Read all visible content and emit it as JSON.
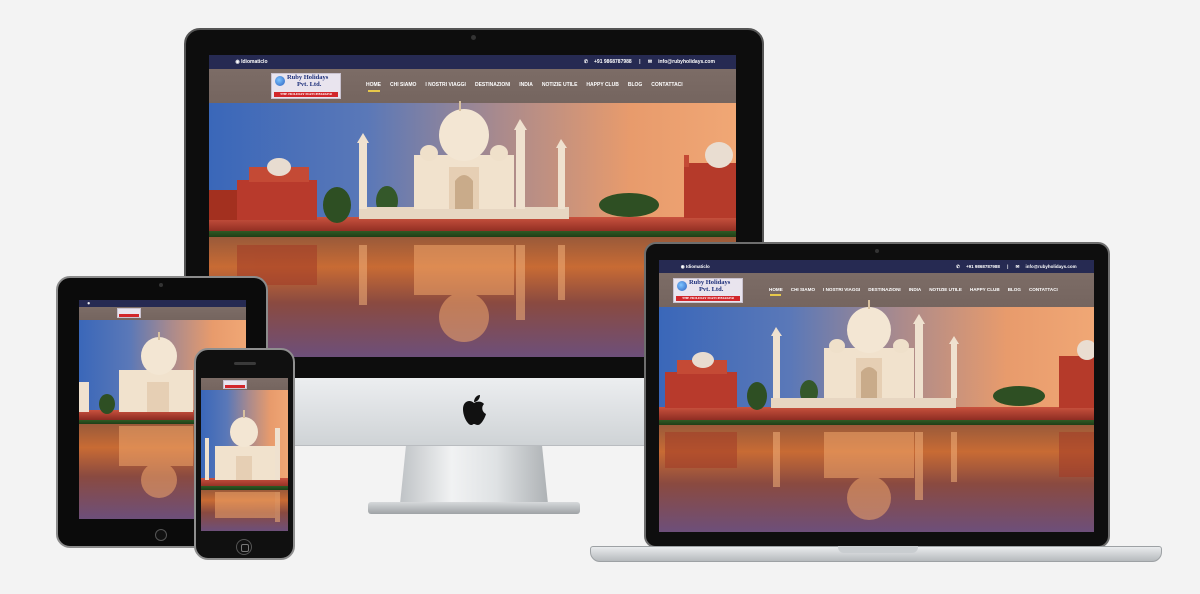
{
  "site": {
    "topbar": {
      "language": "Idiomaticlo",
      "phone": "+91 9868787988",
      "email": "info@rubyholidays.com",
      "separator": "|"
    },
    "logo": {
      "name_line1": "Ruby Holidays",
      "name_line2": "Pvt. Ltd.",
      "tagline": "THE HOLIDAY MATCHMAKER"
    },
    "nav": [
      {
        "label": "HOME",
        "active": true
      },
      {
        "label": "CHI SIAMO",
        "active": false
      },
      {
        "label": "I NOSTRI VIAGGI",
        "active": false
      },
      {
        "label": "DESTINAZIONI",
        "active": false
      },
      {
        "label": "INDIA",
        "active": false
      },
      {
        "label": "NOTIZIE UTILE",
        "active": false
      },
      {
        "label": "HAPPY CLUB",
        "active": false
      },
      {
        "label": "BLOG",
        "active": false
      },
      {
        "label": "CONTATTACI",
        "active": false
      }
    ]
  },
  "colors": {
    "topbar": "#262a52",
    "navbar": "#76665f",
    "nav_active_underline": "#e7c84a",
    "logo_tag": "#d2262b",
    "page_background": "#f3f3f3"
  },
  "devices": [
    "imac",
    "macbook-pro",
    "ipad",
    "iphone"
  ]
}
